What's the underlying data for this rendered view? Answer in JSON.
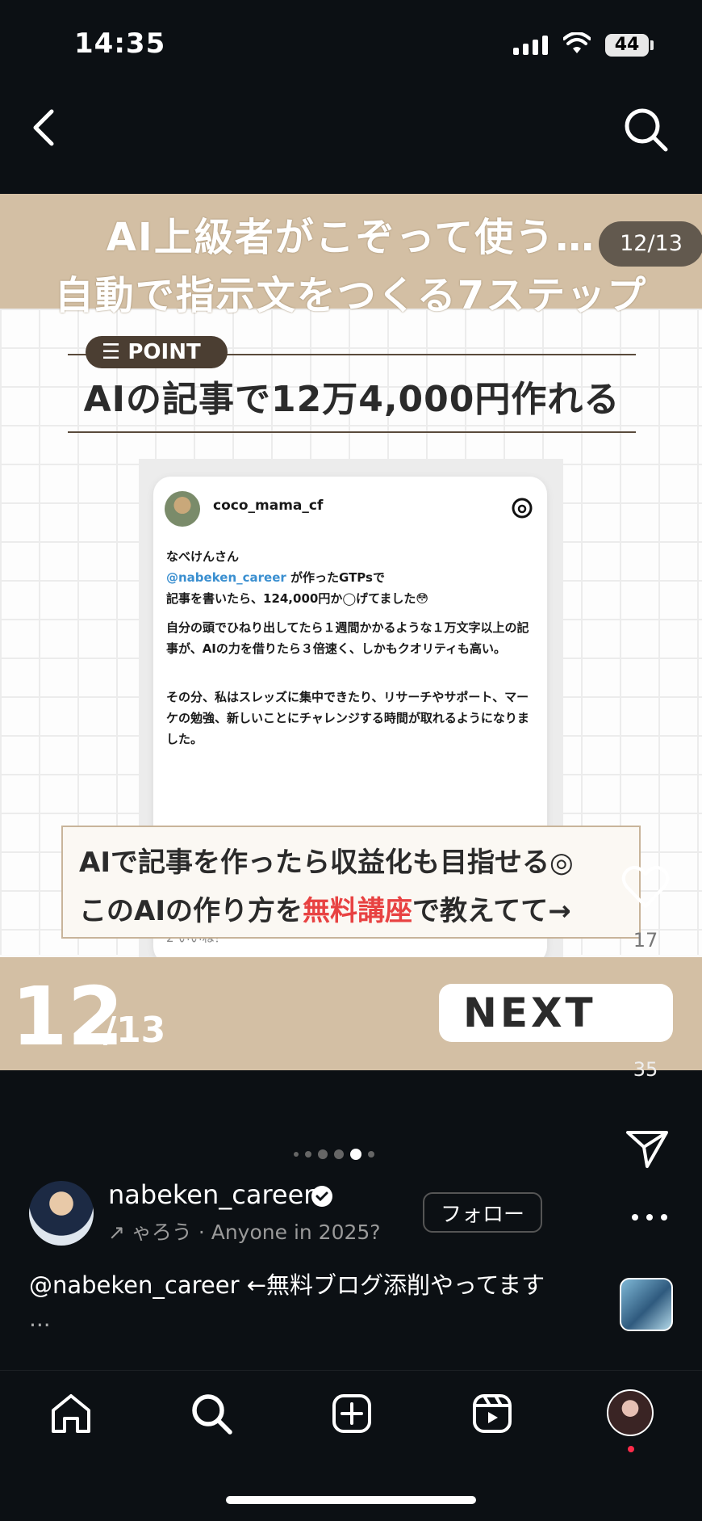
{
  "status_bar": {
    "time": "14:35",
    "battery": "44"
  },
  "post_image": {
    "title_line1": "AI上級者がこぞって使う…",
    "title_line2": "自動で指示文をつくる7ステップ",
    "page_indicator": "12/13",
    "point_label": "POINT",
    "point_title": "AIの記事で12万4,000円作れる",
    "quoted_post": {
      "username": "coco_mama_cf",
      "greeting": "なべけんさん",
      "mention": "@nabeken_career",
      "line2_rest": " が作ったGTPsで",
      "line3": "記事を書いたら、124,000円か◯げてました😳",
      "para2": "自分の頭でひねり出してたら１週間かかるような１万文字以上の記事が、AIの力を借りたら３倍速く、しかもクオリティも高い。",
      "para3": "その分、私はスレッズに集中できたり、リサーチやサポート、マーケの勉強、新しいことにチャレンジする時間が取れるようになりました。",
      "likes": "2 いいね！"
    },
    "cta_line1": "AIで記事を作ったら収益化も目指せる◎",
    "cta_line2_pre": "このAIの作り方を",
    "cta_line2_highlight": "無料講座",
    "cta_line2_post": "で教えてて→",
    "page_big": "12",
    "page_total": "/13",
    "next_label": "NEXT"
  },
  "actions": {
    "like_count": "17",
    "comment_count": "35"
  },
  "author": {
    "name": "nabeken_career",
    "subtitle": "↗ ゃろう · Anyone in 2025?",
    "follow_label": "フォロー"
  },
  "caption": {
    "text": "@nabeken_career ←無料ブログ添削やってます",
    "more": "..."
  },
  "colors": {
    "banner": "#d3bfa4",
    "highlight": "#e84242",
    "mention": "#3a8fd0"
  },
  "icons": [
    "back-icon",
    "search-icon",
    "heart-icon",
    "comment-icon",
    "share-icon",
    "more-icon",
    "home-icon",
    "search-tab-icon",
    "create-icon",
    "reels-icon",
    "threads-icon",
    "verified-icon"
  ]
}
